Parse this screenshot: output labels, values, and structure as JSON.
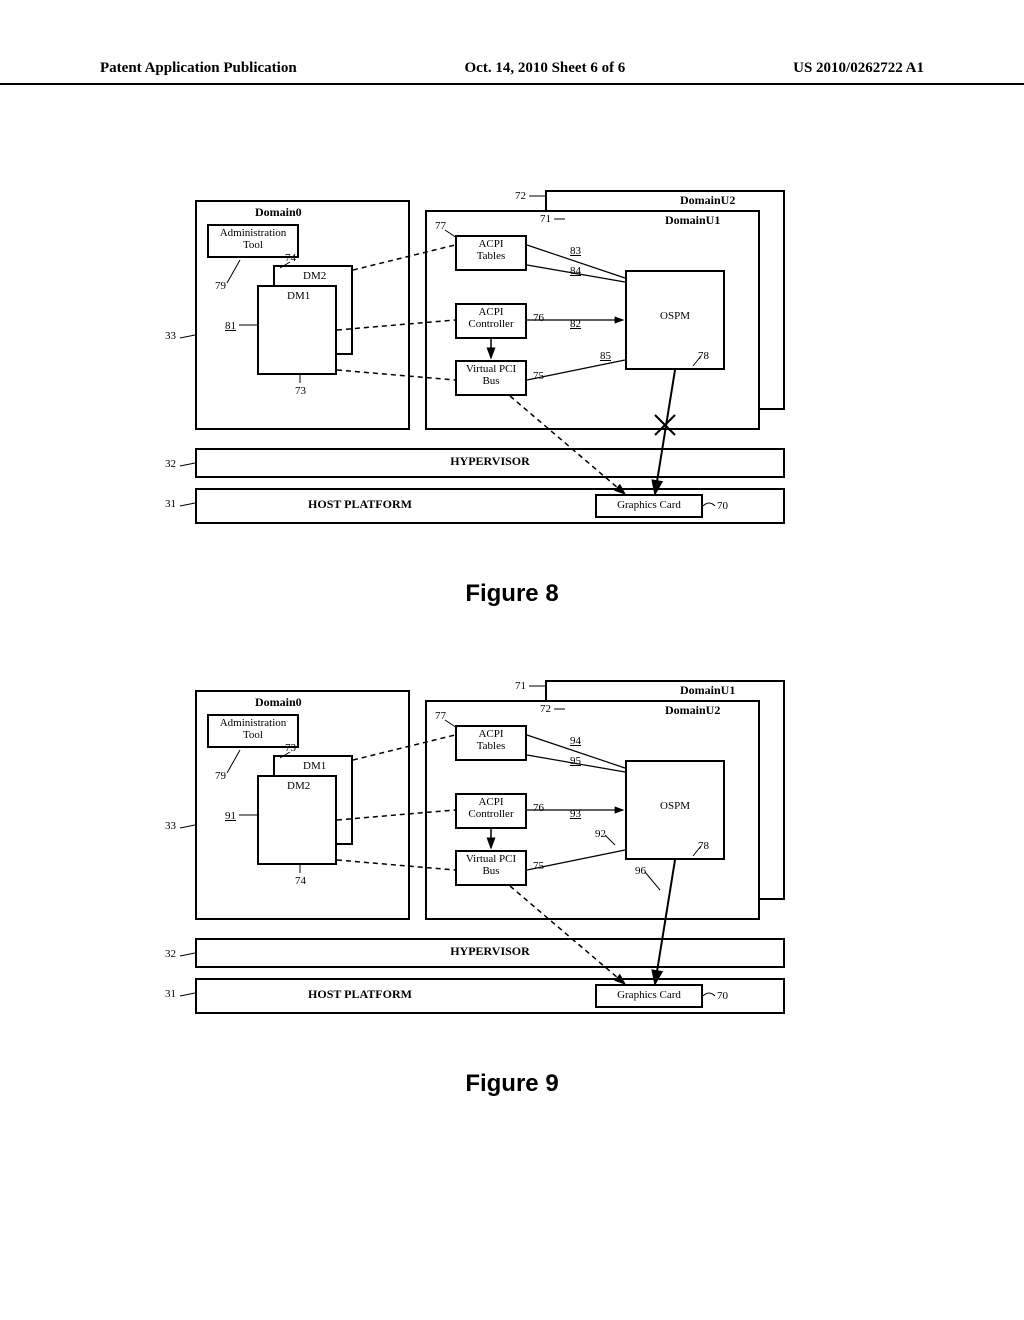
{
  "header": {
    "left": "Patent Application Publication",
    "center": "Oct. 14, 2010  Sheet 6 of 6",
    "right": "US 2010/0262722 A1"
  },
  "figure8": {
    "caption": "Figure  8",
    "domain0": "Domain0",
    "adminTool": "Administration\nTool",
    "dm2": "DM2",
    "dm1": "DM1",
    "domainU2": "DomainU2",
    "domainU1": "DomainU1",
    "acpiTables": "ACPI\nTables",
    "acpiController": "ACPI\nController",
    "virtualPci": "Virtual PCI\nBus",
    "ospm": "OSPM",
    "hypervisor": "HYPERVISOR",
    "hostPlatform": "HOST PLATFORM",
    "graphicsCard": "Graphics Card",
    "refs": {
      "r33": "33",
      "r32": "32",
      "r31": "31",
      "r72": "72",
      "r71": "71",
      "r77": "77",
      "r74": "74",
      "r79": "79",
      "r81": "81",
      "r73": "73",
      "r76": "76",
      "r75": "75",
      "r83": "83",
      "r84": "84",
      "r82": "82",
      "r85": "85",
      "r78": "78",
      "r70": "70"
    }
  },
  "figure9": {
    "caption": "Figure  9",
    "domain0": "Domain0",
    "adminTool": "Administration\nTool",
    "dm1": "DM1",
    "dm2": "DM2",
    "domainU1": "DomainU1",
    "domainU2": "DomainU2",
    "acpiTables": "ACPI\nTables",
    "acpiController": "ACPI\nController",
    "virtualPci": "Virtual PCI\nBus",
    "ospm": "OSPM",
    "hypervisor": "HYPERVISOR",
    "hostPlatform": "HOST PLATFORM",
    "graphicsCard": "Graphics Card",
    "refs": {
      "r33": "33",
      "r32": "32",
      "r31": "31",
      "r71": "71",
      "r72": "72",
      "r77": "77",
      "r73": "73",
      "r79": "79",
      "r91": "91",
      "r74": "74",
      "r76": "76",
      "r75": "75",
      "r94": "94",
      "r95": "95",
      "r93": "93",
      "r92": "92",
      "r96": "96",
      "r78": "78",
      "r70": "70"
    }
  }
}
